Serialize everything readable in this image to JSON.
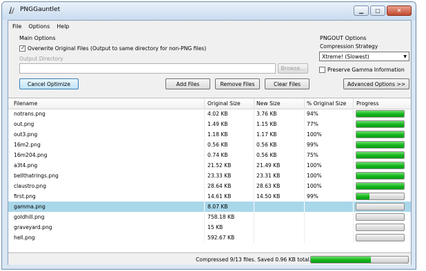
{
  "window": {
    "title": "PNGGauntlet",
    "minimize_glyph": "▁",
    "maximize_glyph": "□",
    "close_glyph": "✕"
  },
  "menu": [
    "File",
    "Options",
    "Help"
  ],
  "main_options": {
    "group_label": "Main Options",
    "overwrite_checked": true,
    "overwrite_label": "Overwrite Original Files (Output to same directory for non-PNG files)",
    "output_dir_label": "Output Directory",
    "output_dir_value": "",
    "browse_label": "Browse..."
  },
  "pngout": {
    "group_label": "PNGOUT Options",
    "strategy_label": "Compression Strategy",
    "strategy_value": "Xtreme! (Slowest)",
    "gamma_checked": false,
    "gamma_label": "Preserve Gamma Information",
    "advanced_label": "Advanced Options >>"
  },
  "actions": {
    "cancel_label": "Cancel Optimize",
    "add_label": "Add Files",
    "remove_label": "Remove Files",
    "clear_label": "Clear Files"
  },
  "table": {
    "columns": [
      "Filename",
      "Original Size",
      "New Size",
      "% Original Size",
      "Progress"
    ],
    "rows": [
      {
        "filename": "notrans.png",
        "original": "4.02 KB",
        "new": "3.76 KB",
        "percent": "94%",
        "progress": 1.0,
        "selected": false
      },
      {
        "filename": "out.png",
        "original": "1.49 KB",
        "new": "1.15 KB",
        "percent": "77%",
        "progress": 1.0,
        "selected": false
      },
      {
        "filename": "out3.png",
        "original": "1.18 KB",
        "new": "1.17 KB",
        "percent": "100%",
        "progress": 1.0,
        "selected": false
      },
      {
        "filename": "16m2.png",
        "original": "0.56 KB",
        "new": "0.56 KB",
        "percent": "99%",
        "progress": 1.0,
        "selected": false
      },
      {
        "filename": "16m204.png",
        "original": "0.74 KB",
        "new": "0.56 KB",
        "percent": "75%",
        "progress": 1.0,
        "selected": false
      },
      {
        "filename": "a3t4.png",
        "original": "21.52 KB",
        "new": "21.49 KB",
        "percent": "100%",
        "progress": 1.0,
        "selected": false
      },
      {
        "filename": "bellthatrings.png",
        "original": "23.33 KB",
        "new": "23.31 KB",
        "percent": "100%",
        "progress": 1.0,
        "selected": false
      },
      {
        "filename": "claustro.png",
        "original": "28.64 KB",
        "new": "28.63 KB",
        "percent": "100%",
        "progress": 1.0,
        "selected": false
      },
      {
        "filename": "first.png",
        "original": "14.61 KB",
        "new": "14.50 KB",
        "percent": "99%",
        "progress": 0.28,
        "selected": false
      },
      {
        "filename": "gamma.png",
        "original": "8.07 KB",
        "new": "",
        "percent": "",
        "progress": 0.0,
        "selected": true
      },
      {
        "filename": "goldhill.png",
        "original": "758.18 KB",
        "new": "",
        "percent": "",
        "progress": 0.0,
        "selected": false
      },
      {
        "filename": "graveyard.png",
        "original": "15 KB",
        "new": "",
        "percent": "",
        "progress": 0.0,
        "selected": false
      },
      {
        "filename": "hell.png",
        "original": "592.67 KB",
        "new": "",
        "percent": "",
        "progress": 0.0,
        "selected": false
      }
    ]
  },
  "status": {
    "text": "Compressed 9/13 files. Saved 0.96 KB total.",
    "progress": 0.62
  },
  "colors": {
    "progress_green": "#13b51b",
    "selected_row": "#a9d7ea"
  }
}
